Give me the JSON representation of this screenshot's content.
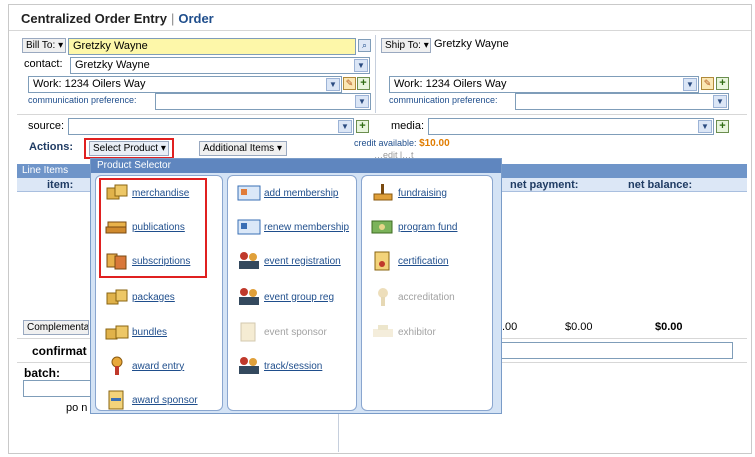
{
  "header": {
    "title": "Centralized Order Entry",
    "separator": "|",
    "subtitle": "Order"
  },
  "bill_to": {
    "label": "Bill To:",
    "value": "Gretzky Wayne"
  },
  "ship_to": {
    "label": "Ship To:",
    "value": "Gretzky Wayne"
  },
  "contact": {
    "label": "contact:",
    "value": "Gretzky Wayne"
  },
  "bill_address": "Work: 1234 Oilers Way",
  "ship_address": "Work: 1234 Oilers Way",
  "comm_pref_label": "communication preference:",
  "source": {
    "label": "source:",
    "value": ""
  },
  "media": {
    "label": "media:",
    "value": ""
  },
  "actions": {
    "label": "Actions:",
    "select_product": "Select Product",
    "additional_items": "Additional Items"
  },
  "credit": {
    "label": "credit available:",
    "value": "$10.00",
    "cut": "…edit l…t"
  },
  "line_items": {
    "title": "Line Items",
    "item_header": "item:",
    "net_payment": "net payment:",
    "net_balance": "net balance:"
  },
  "totals": {
    "v1": ".00",
    "v2": "$0.00",
    "v3": "$0.00"
  },
  "complementary": "Complementar",
  "confirmation": "confirmat",
  "batch": "batch:",
  "po": "po n",
  "popup": {
    "title": "Product Selector",
    "col1": [
      {
        "label": "merchandise",
        "icon": "box-icon",
        "enabled": true
      },
      {
        "label": "publications",
        "icon": "books-icon",
        "enabled": true
      },
      {
        "label": "subscriptions",
        "icon": "subscription-icon",
        "enabled": true
      },
      {
        "label": "packages",
        "icon": "package-icon",
        "enabled": true
      },
      {
        "label": "bundles",
        "icon": "bundle-icon",
        "enabled": true
      },
      {
        "label": "award entry",
        "icon": "award-icon",
        "enabled": true
      },
      {
        "label": "award sponsor",
        "icon": "certificate-icon",
        "enabled": true
      }
    ],
    "col2": [
      {
        "label": "add membership",
        "icon": "membership-card-icon",
        "enabled": true
      },
      {
        "label": "renew membership",
        "icon": "membership-card-icon",
        "enabled": true
      },
      {
        "label": "event registration",
        "icon": "people-icon",
        "enabled": true
      },
      {
        "label": "event group reg",
        "icon": "people-icon",
        "enabled": true
      },
      {
        "label": "event sponsor",
        "icon": "sponsor-icon",
        "enabled": false
      },
      {
        "label": "track/session",
        "icon": "people-icon",
        "enabled": true
      }
    ],
    "col3": [
      {
        "label": "fundraising",
        "icon": "fundraising-icon",
        "enabled": true
      },
      {
        "label": "program fund",
        "icon": "money-icon",
        "enabled": true
      },
      {
        "label": "certification",
        "icon": "certification-icon",
        "enabled": true
      },
      {
        "label": "accreditation",
        "icon": "accreditation-icon",
        "enabled": false
      },
      {
        "label": "exhibitor",
        "icon": "exhibitor-icon",
        "enabled": false
      }
    ]
  }
}
